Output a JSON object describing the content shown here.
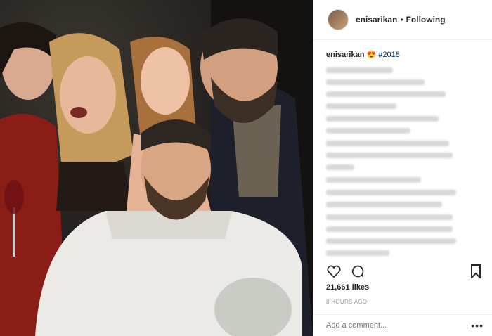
{
  "post": {
    "username": "enisarikan",
    "separator": "•",
    "follow_status": "Following",
    "caption": {
      "username": "enisarikan",
      "emoji": "😍",
      "hashtag": "#2018"
    },
    "likes": "21,661 likes",
    "timestamp": "8 HOURS AGO",
    "comment_placeholder": "Add a comment...",
    "more_label": "•••"
  },
  "icons": {
    "like": "heart-icon",
    "comment": "comment-bubble-icon",
    "save": "bookmark-icon",
    "more": "more-options-icon"
  },
  "colors": {
    "text": "#262626",
    "muted": "#999999",
    "border": "#efefef",
    "hashtag": "#003569"
  }
}
